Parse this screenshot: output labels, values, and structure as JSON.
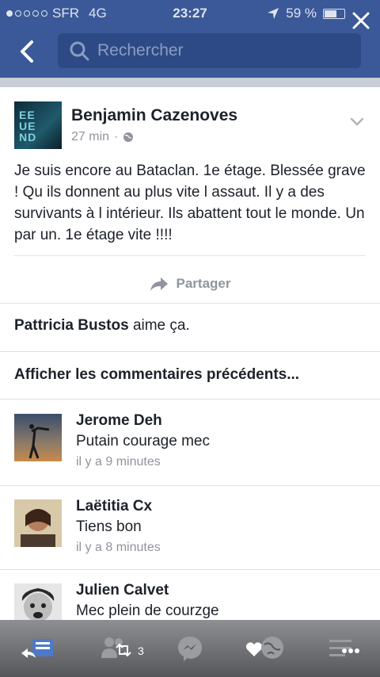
{
  "status": {
    "carrier": "SFR",
    "network": "4G",
    "time": "23:27",
    "battery": "59 %"
  },
  "nav": {
    "search_placeholder": "Rechercher"
  },
  "post": {
    "author": "Benjamin Cazenoves",
    "time": "27 min",
    "text": "Je suis encore au Bataclan. 1e étage. Blessée grave ! Qu ils donnent au plus vite l assaut. Il y a des survivants à l intérieur. Ils abattent tout le monde. Un par un. 1e étage vite !!!!",
    "share_label": "Partager"
  },
  "likes": {
    "name": "Pattricia Bustos",
    "suffix": "aime ça."
  },
  "prev_comments_label": "Afficher les commentaires précédents...",
  "comments": [
    {
      "name": "Jerome Deh",
      "text": "Putain courage mec",
      "time": "il y a 9 minutes"
    },
    {
      "name": "Laëtitia Cx",
      "text": "Tiens bon",
      "time": "il y a 8 minutes"
    },
    {
      "name": "Julien Calvet",
      "text": "Mec plein de courzge",
      "time": ""
    }
  ],
  "toolbar": {
    "shares_count": "3"
  },
  "colors": {
    "brand": "#3b5998",
    "search_bg": "#2d4a86",
    "muted_text": "#90949c"
  }
}
